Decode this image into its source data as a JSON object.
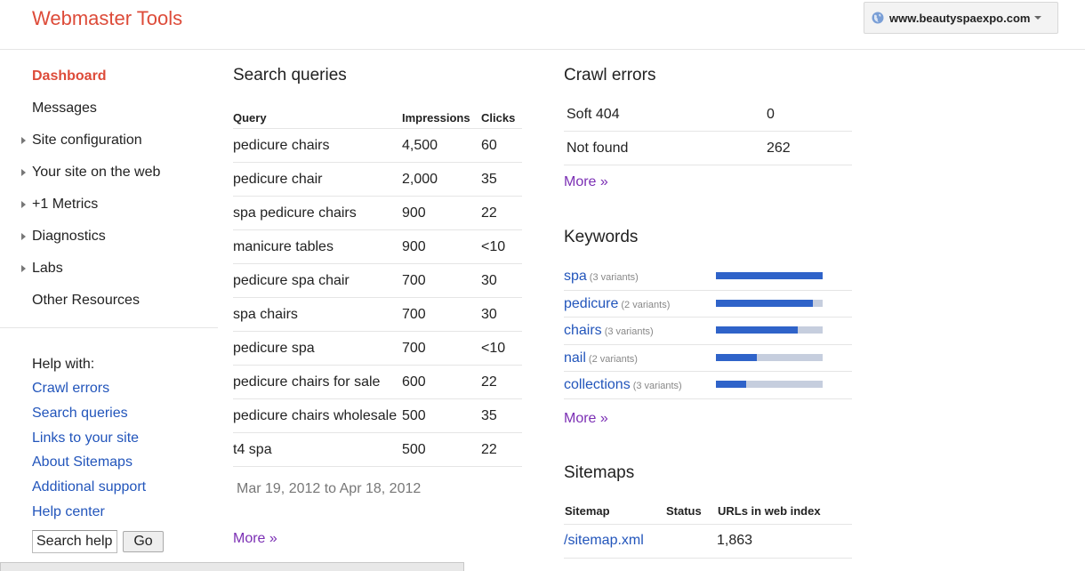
{
  "header": {
    "app_title": "Webmaster Tools",
    "site": "www.beautyspaexpo.com"
  },
  "nav": {
    "items": [
      {
        "label": "Dashboard",
        "active": true,
        "expandable": false
      },
      {
        "label": "Messages",
        "active": false,
        "expandable": false
      },
      {
        "label": "Site configuration",
        "active": false,
        "expandable": true
      },
      {
        "label": "Your site on the web",
        "active": false,
        "expandable": true
      },
      {
        "label": "+1 Metrics",
        "active": false,
        "expandable": true
      },
      {
        "label": "Diagnostics",
        "active": false,
        "expandable": true
      },
      {
        "label": "Labs",
        "active": false,
        "expandable": true
      },
      {
        "label": "Other Resources",
        "active": false,
        "expandable": false
      }
    ]
  },
  "help": {
    "title": "Help with:",
    "links": [
      "Crawl errors",
      "Search queries",
      "Links to your site",
      "About Sitemaps",
      "Additional support",
      "Help center"
    ],
    "search_value": "Search help",
    "go_label": "Go"
  },
  "queries": {
    "title": "Search queries",
    "headers": {
      "query": "Query",
      "impressions": "Impressions",
      "clicks": "Clicks"
    },
    "rows": [
      {
        "query": "pedicure chairs",
        "impressions": "4,500",
        "clicks": "60"
      },
      {
        "query": "pedicure chair",
        "impressions": "2,000",
        "clicks": "35"
      },
      {
        "query": "spa pedicure chairs",
        "impressions": "900",
        "clicks": "22"
      },
      {
        "query": "manicure tables",
        "impressions": "900",
        "clicks": "<10"
      },
      {
        "query": "pedicure spa chair",
        "impressions": "700",
        "clicks": "30"
      },
      {
        "query": "spa chairs",
        "impressions": "700",
        "clicks": "30"
      },
      {
        "query": "pedicure spa",
        "impressions": "700",
        "clicks": "<10"
      },
      {
        "query": "pedicure chairs for sale",
        "impressions": "600",
        "clicks": "22"
      },
      {
        "query": "pedicure chairs wholesale",
        "impressions": "500",
        "clicks": "35"
      },
      {
        "query": "t4 spa",
        "impressions": "500",
        "clicks": "22"
      }
    ],
    "date_range": "Mar 19, 2012 to Apr 18, 2012",
    "more": "More »"
  },
  "crawl_errors": {
    "title": "Crawl errors",
    "rows": [
      {
        "label": "Soft 404",
        "value": "0"
      },
      {
        "label": "Not found",
        "value": "262"
      }
    ],
    "more": "More »"
  },
  "keywords": {
    "title": "Keywords",
    "items": [
      {
        "word": "spa",
        "variants": "(3 variants)",
        "significance": 1.0
      },
      {
        "word": "pedicure",
        "variants": "(2 variants)",
        "significance": 0.91
      },
      {
        "word": "chairs",
        "variants": "(3 variants)",
        "significance": 0.77
      },
      {
        "word": "nail",
        "variants": "(2 variants)",
        "significance": 0.38
      },
      {
        "word": "collections",
        "variants": "(3 variants)",
        "significance": 0.28
      }
    ],
    "more": "More »"
  },
  "sitemaps": {
    "title": "Sitemaps",
    "headers": {
      "sitemap": "Sitemap",
      "status": "Status",
      "urls": "URLs in web index"
    },
    "rows": [
      {
        "sitemap": "/sitemap.xml",
        "status": "",
        "urls": "1,863"
      }
    ]
  },
  "colors": {
    "accent": "#dd4b39",
    "link": "#2255bb",
    "visited": "#7b2fb4",
    "bar": "#2f63c9",
    "bar_bg": "#c6cede"
  }
}
